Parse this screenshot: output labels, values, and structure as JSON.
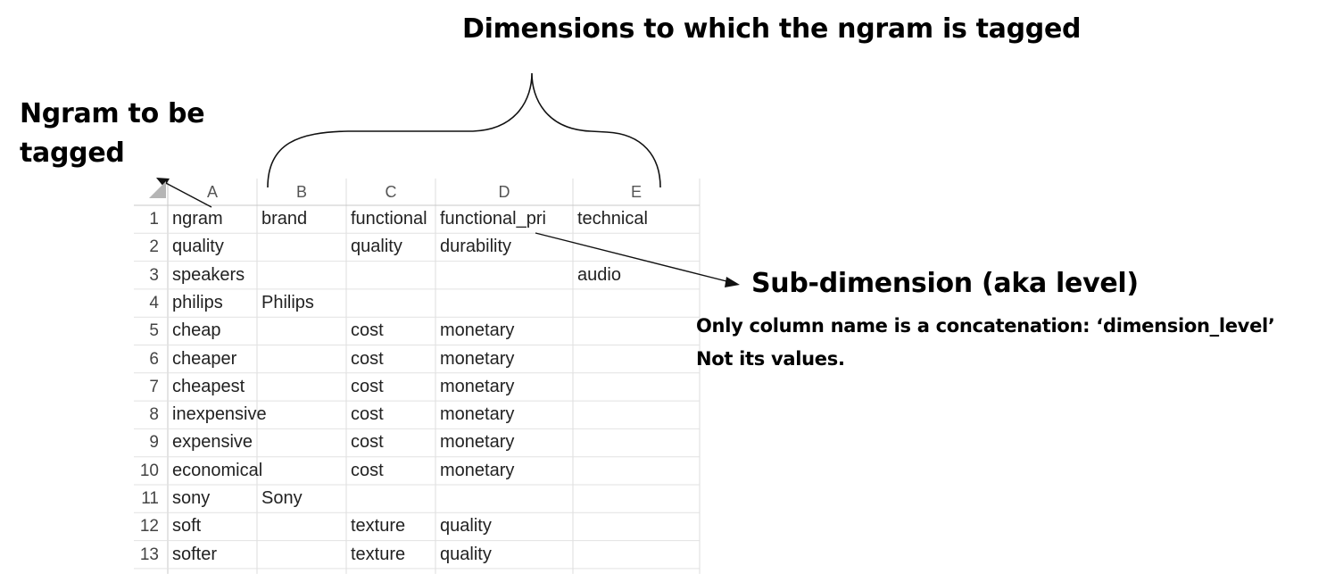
{
  "annotations": {
    "top_title": "Dimensions to which the ngram is tagged",
    "left_title": "Ngram to be tagged",
    "sub_title": "Sub-dimension (aka level)",
    "note_line1": "Only column name is a concatenation: ‘dimension_level’",
    "note_line2": "Not its values."
  },
  "spreadsheet": {
    "column_headers": [
      "A",
      "B",
      "C",
      "D",
      "E"
    ],
    "rows": [
      {
        "num": "1",
        "cells": [
          "ngram",
          "brand",
          "functional",
          "functional_pri",
          "technical"
        ]
      },
      {
        "num": "2",
        "cells": [
          "quality",
          "",
          "quality",
          "durability",
          ""
        ]
      },
      {
        "num": "3",
        "cells": [
          "speakers",
          "",
          "",
          "",
          "audio"
        ]
      },
      {
        "num": "4",
        "cells": [
          "philips",
          "Philips",
          "",
          "",
          ""
        ]
      },
      {
        "num": "5",
        "cells": [
          "cheap",
          "",
          "cost",
          "monetary",
          ""
        ]
      },
      {
        "num": "6",
        "cells": [
          "cheaper",
          "",
          "cost",
          "monetary",
          ""
        ]
      },
      {
        "num": "7",
        "cells": [
          "cheapest",
          "",
          "cost",
          "monetary",
          ""
        ]
      },
      {
        "num": "8",
        "cells": [
          "inexpensive",
          "",
          "cost",
          "monetary",
          ""
        ]
      },
      {
        "num": "9",
        "cells": [
          "expensive",
          "",
          "cost",
          "monetary",
          ""
        ]
      },
      {
        "num": "10",
        "cells": [
          "economical",
          "",
          "cost",
          "monetary",
          ""
        ]
      },
      {
        "num": "11",
        "cells": [
          "sony",
          "Sony",
          "",
          "",
          ""
        ]
      },
      {
        "num": "12",
        "cells": [
          "soft",
          "",
          "texture",
          "quality",
          ""
        ]
      },
      {
        "num": "13",
        "cells": [
          "softer",
          "",
          "texture",
          "quality",
          ""
        ]
      }
    ]
  }
}
